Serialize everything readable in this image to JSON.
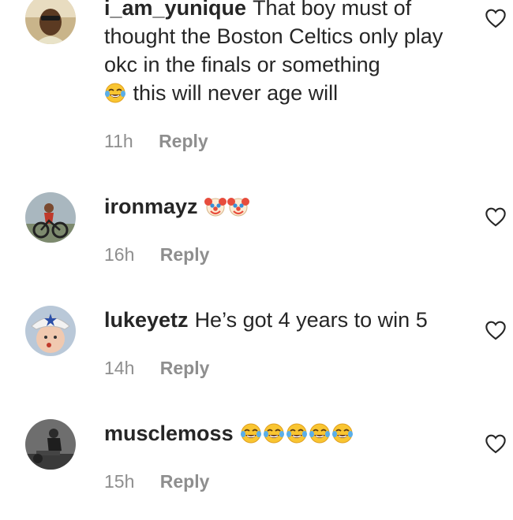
{
  "comments": [
    {
      "username": "i_am_yunique",
      "text_before_emoji": "That boy must of thought the Boston Celtics only play okc in the finals or something",
      "emoji": "face-with-tears-of-joy",
      "text_after_emoji": "this will never age will",
      "time": "11h",
      "reply_label": "Reply"
    },
    {
      "username": "ironmayz",
      "emoji": "clown-face",
      "emoji_count": 2,
      "time": "16h",
      "reply_label": "Reply"
    },
    {
      "username": "lukeyetz",
      "text": "He’s got 4 years to win 5",
      "time": "14h",
      "reply_label": "Reply"
    },
    {
      "username": "musclemoss",
      "emoji": "face-with-tears-of-joy",
      "emoji_count": 5,
      "time": "15h",
      "reply_label": "Reply"
    }
  ],
  "colors": {
    "text": "#262626",
    "meta": "#8e8e8e"
  }
}
